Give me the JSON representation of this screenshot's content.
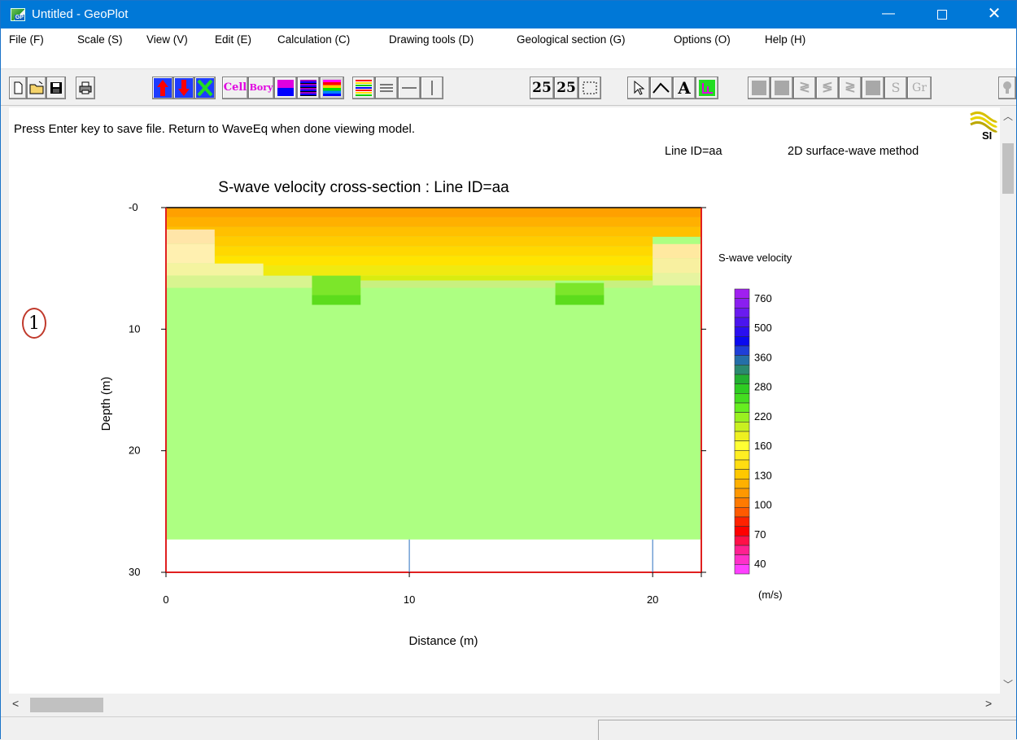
{
  "window": {
    "title": "Untitled - GeoPlot",
    "app_icon_label": "GP",
    "minimize": "—",
    "close": "✕"
  },
  "menu": [
    "File (F)",
    "Scale (S)",
    "View (V)",
    "Edit (E)",
    "Calculation (C)",
    "Drawing tools (D)",
    "Geological section (G)",
    "Options (O)",
    "Help (H)"
  ],
  "toolbar": {
    "cell_label": "Cell",
    "bory_label": "Bory",
    "num1": "25",
    "num2": "25",
    "text_tool": "A",
    "s_label": "S",
    "gr_label": "Gr"
  },
  "status_message": "Press Enter key to save file. Return to WaveEq when done viewing model.",
  "line_info": "Line ID=aa",
  "method_info": "2D surface-wave method",
  "circle_label": "1",
  "logo_text": "SI",
  "chart_data": {
    "type": "heatmap",
    "title": "S-wave velocity cross-section : Line ID=aa",
    "xlabel": "Distance (m)",
    "ylabel": "Depth (m)",
    "xlim": [
      0,
      22
    ],
    "ylim": [
      0,
      30
    ],
    "y_inverted": true,
    "x_ticks": [
      "0",
      "10",
      "20"
    ],
    "y_ticks": [
      "-0",
      "10",
      "20",
      "30"
    ],
    "model_bottom_depth": 27.3,
    "vertical_markers_x": [
      10,
      20
    ],
    "colorbar": {
      "title": "S-wave velocity",
      "unit": "(m/s)",
      "labels": [
        "760",
        "500",
        "360",
        "280",
        "220",
        "160",
        "130",
        "100",
        "70",
        "40"
      ],
      "colors": [
        "#a020f0",
        "#8a1ff0",
        "#6a1af0",
        "#4a14ee",
        "#2a0ff0",
        "#0a0af0",
        "#1f3fd8",
        "#246fa8",
        "#2a8a6e",
        "#22b030",
        "#2ecc22",
        "#44dd20",
        "#66ee20",
        "#99f020",
        "#c8f020",
        "#eef020",
        "#ffff33",
        "#ffee22",
        "#ffdd11",
        "#ffc800",
        "#ffb000",
        "#ff9800",
        "#ff7a00",
        "#ff5a00",
        "#ff2200",
        "#ff0000",
        "#ff1048",
        "#ff2090",
        "#ff30c8",
        "#ff40ff"
      ]
    },
    "cells": [
      {
        "x0": 0,
        "x1": 22,
        "y0": 0,
        "y1": 0.8,
        "color": "#ffa000"
      },
      {
        "x0": 0,
        "x1": 22,
        "y0": 0.8,
        "y1": 1.6,
        "color": "#ffb000"
      },
      {
        "x0": 0,
        "x1": 22,
        "y0": 1.6,
        "y1": 2.4,
        "color": "#ffc000"
      },
      {
        "x0": 2,
        "x1": 20,
        "y0": 2.4,
        "y1": 3.2,
        "color": "#ffcc00"
      },
      {
        "x0": 2,
        "x1": 20,
        "y0": 3.2,
        "y1": 4.0,
        "color": "#ffd800"
      },
      {
        "x0": 2,
        "x1": 20,
        "y0": 4.0,
        "y1": 4.8,
        "color": "#ffe400"
      },
      {
        "x0": 4,
        "x1": 20,
        "y0": 4.8,
        "y1": 5.6,
        "color": "#f0ea10"
      },
      {
        "x0": 4,
        "x1": 20,
        "y0": 5.6,
        "y1": 6.0,
        "color": "#d8ec10"
      },
      {
        "x0": 6,
        "x1": 8,
        "y0": 5.6,
        "y1": 7.2,
        "color": "#7ce62a"
      },
      {
        "x0": 16,
        "x1": 18,
        "y0": 6.2,
        "y1": 7.2,
        "color": "#7ce62a"
      },
      {
        "x0": 6,
        "x1": 8,
        "y0": 7.2,
        "y1": 8.0,
        "color": "#5cdc1c"
      },
      {
        "x0": 16,
        "x1": 18,
        "y0": 7.2,
        "y1": 8.0,
        "color": "#5cdc1c"
      },
      {
        "x0": 0,
        "x1": 2,
        "y0": 1.8,
        "y1": 3.0,
        "color": "#ffe5a8"
      },
      {
        "x0": 0,
        "x1": 2,
        "y0": 3.0,
        "y1": 4.6,
        "color": "#fff0b0"
      },
      {
        "x0": 0,
        "x1": 4,
        "y0": 4.6,
        "y1": 5.6,
        "color": "#f4f4a0"
      },
      {
        "x0": 0,
        "x1": 6,
        "y0": 5.6,
        "y1": 6.6,
        "color": "#d8f490"
      },
      {
        "x0": 20,
        "x1": 22,
        "y0": 3.0,
        "y1": 4.2,
        "color": "#ffe9a0"
      },
      {
        "x0": 20,
        "x1": 22,
        "y0": 4.2,
        "y1": 5.4,
        "color": "#f8f0a0"
      },
      {
        "x0": 20,
        "x1": 22,
        "y0": 5.4,
        "y1": 6.4,
        "color": "#e6f4a0"
      },
      {
        "x0": 8,
        "x1": 16,
        "y0": 6.0,
        "y1": 6.6,
        "color": "#c8f080"
      },
      {
        "x0": 18,
        "x1": 20,
        "y0": 6.0,
        "y1": 6.6,
        "color": "#c8f080"
      }
    ],
    "base_color": "#adff82"
  }
}
